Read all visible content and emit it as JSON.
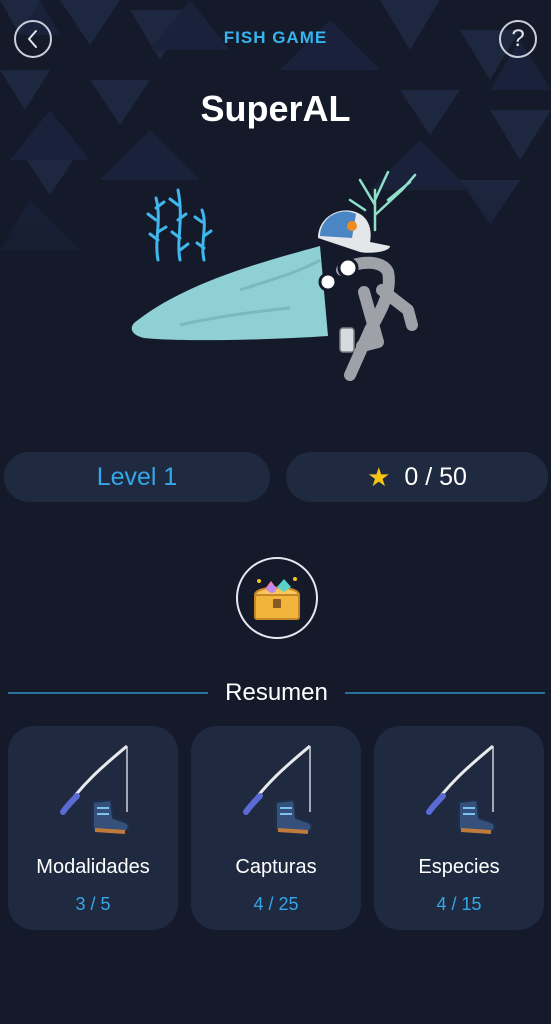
{
  "header": {
    "title": "FISH GAME",
    "back_icon": "chevron-left-icon",
    "help_label": "?"
  },
  "player": {
    "name": "SuperAL"
  },
  "level": {
    "label": "Level 1"
  },
  "stars": {
    "icon": "star-icon",
    "text": "0 / 50"
  },
  "rewards": {
    "icon": "treasure-chest-icon"
  },
  "summary": {
    "title": "Resumen",
    "cards": [
      {
        "icon": "fishing-rod-boot-icon",
        "label": "Modalidades",
        "value": "3 / 5"
      },
      {
        "icon": "fishing-rod-boot-icon",
        "label": "Capturas",
        "value": "4 / 25"
      },
      {
        "icon": "fishing-rod-boot-icon",
        "label": "Especies",
        "value": "4 / 15"
      }
    ]
  },
  "colors": {
    "background": "#151a2a",
    "card": "#1f2a40",
    "accent": "#35b4ee",
    "star": "#f5c518"
  }
}
